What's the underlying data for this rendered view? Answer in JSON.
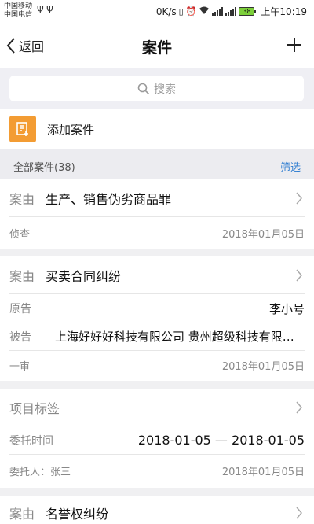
{
  "status_bar": {
    "carrier_1": "中国移动",
    "carrier_2": "中国电信",
    "usb": "Ψ Ψ",
    "speed": "0K/s",
    "battery": "38",
    "time": "上午10:19"
  },
  "nav": {
    "back_label": "返回",
    "title": "案件"
  },
  "search": {
    "placeholder": "搜索"
  },
  "add_case": {
    "label": "添加案件"
  },
  "section": {
    "count_label": "全部案件(38)",
    "filter_label": "筛选"
  },
  "cases": [
    {
      "cause_label": "案由",
      "cause": "生产、销售伪劣商品罪",
      "stage": "侦查",
      "date": "2018年01月05日"
    },
    {
      "cause_label": "案由",
      "cause": "买卖合同纠纷",
      "plaintiff_label": "原告",
      "plaintiff": "李小号",
      "defendant_label": "被告",
      "defendant": "上海好好好科技有限公司  贵州超级科技有限公司",
      "stage": "一审",
      "date": "2018年01月05日"
    },
    {
      "tag_label": "项目标签",
      "entrust_time_label": "委托时间",
      "entrust_time": "2018-01-05 — 2018-01-05",
      "client": "委托人：张三",
      "date": "2018年01月05日"
    },
    {
      "cause_label": "案由",
      "cause": "名誉权纠纷"
    }
  ]
}
